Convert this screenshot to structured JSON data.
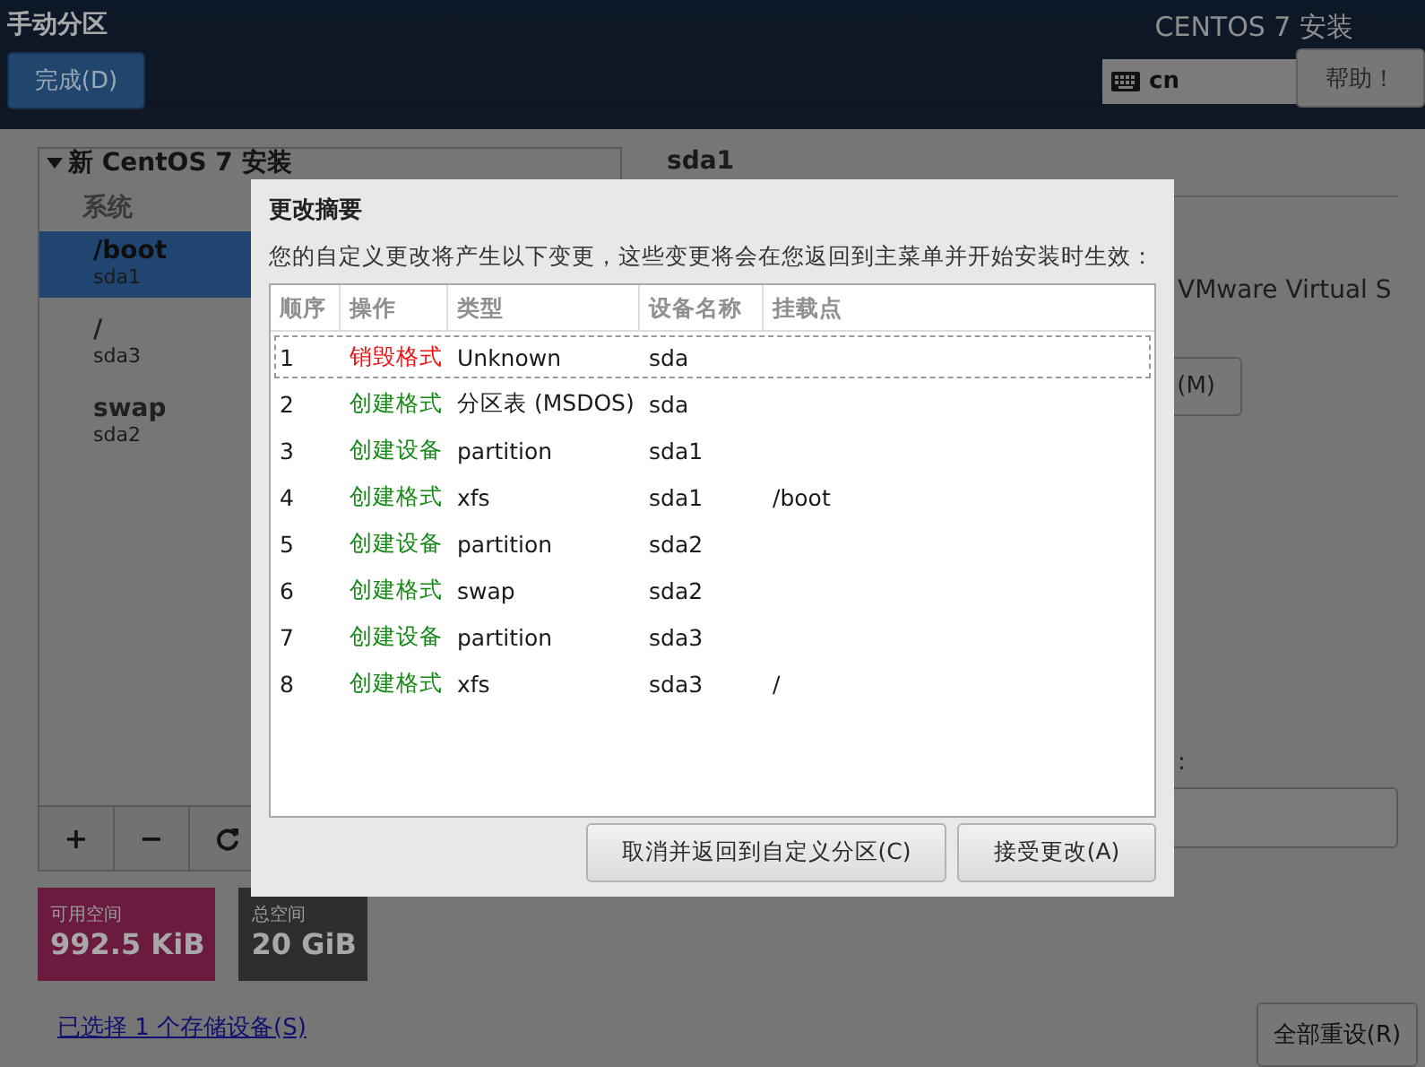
{
  "header": {
    "title": "手动分区",
    "done_button": "完成(D)",
    "product": "CENTOS 7 安装",
    "keyboard_layout": "cn",
    "help_button": "帮助！"
  },
  "partition_panel": {
    "heading": "新 CentOS 7 安装",
    "expanded": true,
    "section": "系统",
    "items": [
      {
        "mount": "/boot",
        "device": "sda1",
        "selected": true
      },
      {
        "mount": "/",
        "device": "sda3",
        "selected": false
      },
      {
        "mount": "swap",
        "device": "sda2",
        "selected": false
      }
    ],
    "toolbar": [
      "+",
      "−"
    ]
  },
  "space": [
    {
      "label": "可用空间",
      "value": "992.5 KiB",
      "color": "#6b1a40"
    },
    {
      "label": "总空间",
      "value": "20 GiB",
      "color": "#2e2e2e"
    }
  ],
  "storage_link": "已选择 1 个存储设备(S)",
  "detail": {
    "device_title": "sda1",
    "device_model": "VMware Virtual S",
    "modify_button": "(M)",
    "field_label": ":"
  },
  "reset_button": "全部重设(R)",
  "dialog": {
    "title": "更改摘要",
    "description": "您的自定义更改将产生以下变更，这些变更将会在您返回到主菜单并开始安装时生效：",
    "columns": [
      "顺序",
      "操作",
      "类型",
      "设备名称",
      "挂载点"
    ],
    "rows": [
      {
        "order": "1",
        "action": "销毁格式",
        "kind": "destroy",
        "type": "Unknown",
        "device": "sda",
        "mount": "",
        "selected": true
      },
      {
        "order": "2",
        "action": "创建格式",
        "kind": "create",
        "type": "分区表 (MSDOS)",
        "device": "sda",
        "mount": "",
        "selected": false
      },
      {
        "order": "3",
        "action": "创建设备",
        "kind": "create",
        "type": "partition",
        "device": "sda1",
        "mount": "",
        "selected": false
      },
      {
        "order": "4",
        "action": "创建格式",
        "kind": "create",
        "type": "xfs",
        "device": "sda1",
        "mount": "/boot",
        "selected": false
      },
      {
        "order": "5",
        "action": "创建设备",
        "kind": "create",
        "type": "partition",
        "device": "sda2",
        "mount": "",
        "selected": false
      },
      {
        "order": "6",
        "action": "创建格式",
        "kind": "create",
        "type": "swap",
        "device": "sda2",
        "mount": "",
        "selected": false
      },
      {
        "order": "7",
        "action": "创建设备",
        "kind": "create",
        "type": "partition",
        "device": "sda3",
        "mount": "",
        "selected": false
      },
      {
        "order": "8",
        "action": "创建格式",
        "kind": "create",
        "type": "xfs",
        "device": "sda3",
        "mount": "/",
        "selected": false
      }
    ],
    "buttons": [
      "取消并返回到自定义分区(C)",
      "接受更改(A)"
    ]
  }
}
